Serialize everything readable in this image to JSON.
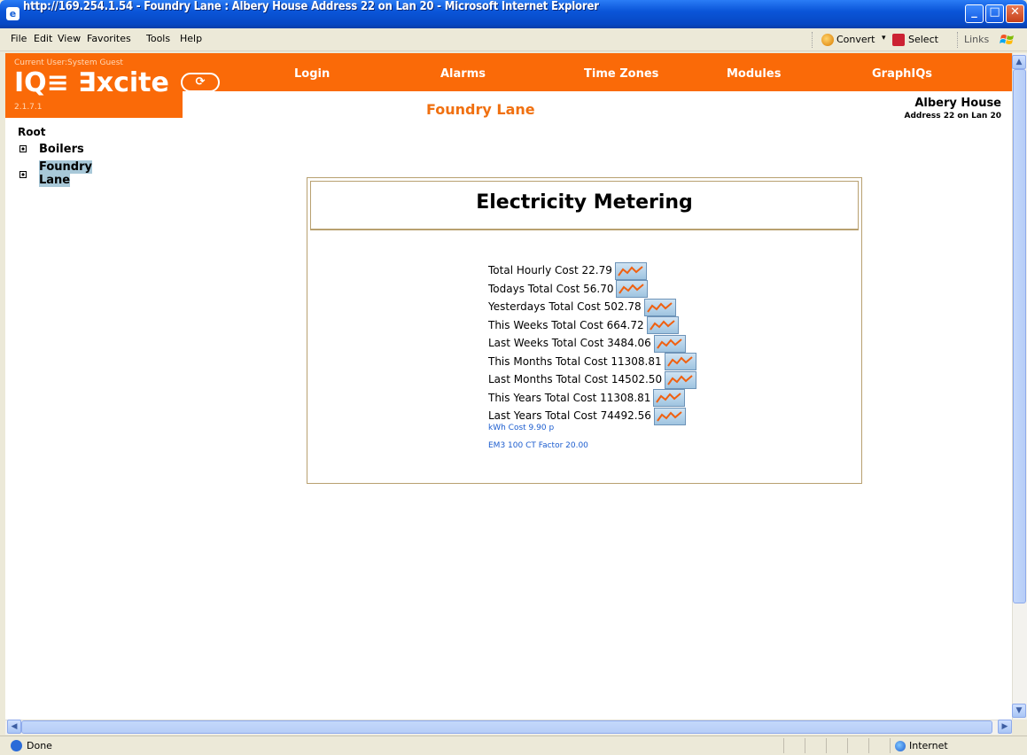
{
  "window": {
    "title": "http://169.254.1.54 - Foundry Lane : Albery House Address 22 on Lan 20 - Microsoft Internet Explorer",
    "icon_glyph": "e",
    "min_glyph": "_",
    "max_glyph": "□",
    "close_glyph": "✕"
  },
  "menu": [
    "File",
    "Edit",
    "View",
    "Favorites",
    "Tools",
    "Help"
  ],
  "toolbar": {
    "convert": "Convert",
    "convert_arrow": "▾",
    "select": "Select",
    "links": "Links"
  },
  "header": {
    "current_user": "Current User:System Guest",
    "logo": "IQ≡ ∃xcite",
    "refresh_glyph": "⟳",
    "version": "2.1.7.1",
    "nav": [
      "Login",
      "Alarms",
      "Time Zones",
      "Modules",
      "GraphIQs"
    ],
    "page_title": "Foundry Lane",
    "site_name": "Albery House",
    "site_address": "Address 22 on Lan 20",
    "accent": "#fa6a08"
  },
  "tree": {
    "root": "Root",
    "items": [
      "Boilers",
      "Foundry Lane"
    ]
  },
  "panel": {
    "title": "Electricity Metering",
    "rows": [
      "Total Hourly Cost 22.79",
      "Todays Total Cost 56.70",
      "Yesterdays Total Cost 502.78",
      "This Weeks Total Cost 664.72",
      "Last Weeks Total Cost 3484.06",
      "This Months Total Cost 11308.81",
      "Last Months Total Cost 14502.50",
      "This Years Total Cost 11308.81",
      "Last Years Total Cost 74492.56"
    ],
    "notes": [
      "kWh Cost 9.90 p",
      "EM3 100 CT Factor 20.00"
    ]
  },
  "scroll": {
    "up": "▲",
    "down": "▼",
    "left": "◀",
    "right": "▶"
  },
  "status": {
    "text": "Done",
    "zone": "Internet"
  }
}
